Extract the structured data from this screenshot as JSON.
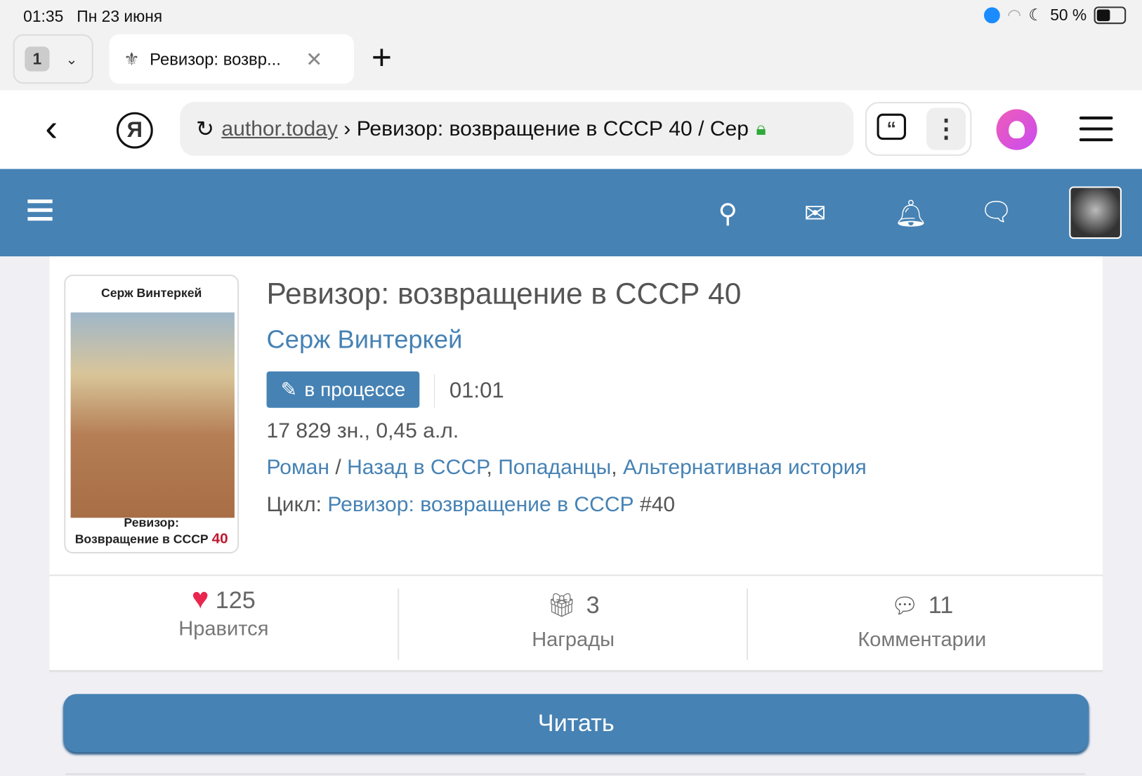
{
  "status_bar": {
    "time": "01:35",
    "date": "Пн 23 июня",
    "battery": "50 %"
  },
  "browser": {
    "tab_count": "1",
    "tab_title": "Ревизор: возвр...",
    "url_domain": "author.today",
    "url_sep": "›",
    "url_title": "Ревизор: возвращение в СССР 40 / Сер"
  },
  "book": {
    "title": "Ревизор: возвращение в СССР 40",
    "author": "Серж Винтеркей",
    "status": "в процессе",
    "time": "01:01",
    "size": "17 829 зн., 0,45 а.л.",
    "genre_main": "Роман",
    "genres": [
      "Назад в СССР",
      "Попаданцы",
      "Альтернативная история"
    ],
    "cycle_label": "Цикл:",
    "cycle_name": "Ревизор: возвращение в СССР",
    "cycle_num": "#40",
    "cover": {
      "author": "Серж Винтеркей",
      "title_line1": "Ревизор:",
      "title_line2": "Возвращение в СССР",
      "num": "40"
    }
  },
  "stats": {
    "likes": {
      "count": "125",
      "label": "Нравится"
    },
    "awards": {
      "count": "3",
      "label": "Награды"
    },
    "comments": {
      "count": "11",
      "label": "Комментарии"
    }
  },
  "read_button": "Читать",
  "colors": {
    "accent": "#4682b4",
    "heart": "#e8264f"
  }
}
